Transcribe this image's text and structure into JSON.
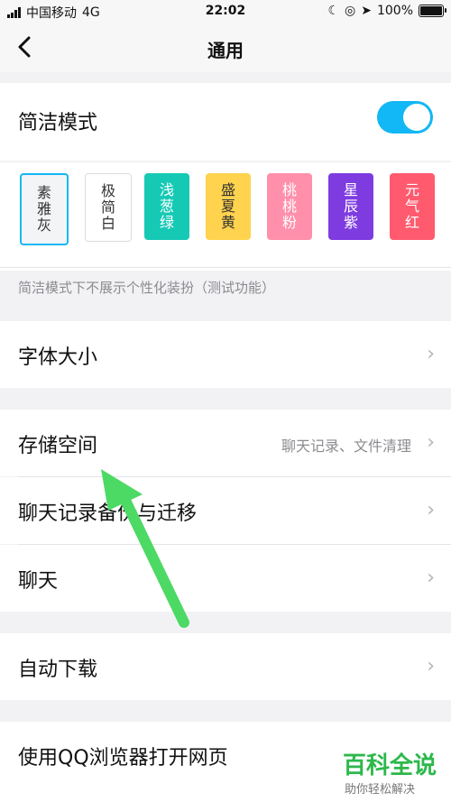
{
  "status_bar": {
    "carrier": "中国移动",
    "network": "4G",
    "time": "22:02",
    "battery": "100%"
  },
  "nav": {
    "title": "通用"
  },
  "simple_mode": {
    "label": "简洁模式",
    "enabled": true,
    "themes": [
      {
        "name": "素雅灰",
        "lines": [
          "素",
          "雅",
          "灰"
        ],
        "color": "#f3f4f6",
        "text_color": "#333333",
        "selected": true
      },
      {
        "name": "极简白",
        "lines": [
          "极",
          "简",
          "白"
        ],
        "color": "#ffffff",
        "text_color": "#333333",
        "selected": false
      },
      {
        "name": "浅葱绿",
        "lines": [
          "浅",
          "葱",
          "绿"
        ],
        "color": "#16c9b5",
        "text_color": "#ffffff",
        "selected": false
      },
      {
        "name": "盛夏黄",
        "lines": [
          "盛",
          "夏",
          "黄"
        ],
        "color": "#ffd34d",
        "text_color": "#333333",
        "selected": false
      },
      {
        "name": "桃桃粉",
        "lines": [
          "桃",
          "桃",
          "粉"
        ],
        "color": "#ff8fab",
        "text_color": "#ffffff",
        "selected": false
      },
      {
        "name": "星辰紫",
        "lines": [
          "星",
          "辰",
          "紫"
        ],
        "color": "#7e3be0",
        "text_color": "#ffffff",
        "selected": false
      },
      {
        "name": "元气红",
        "lines": [
          "元",
          "气",
          "红"
        ],
        "color": "#ff5a6e",
        "text_color": "#ffffff",
        "selected": false
      }
    ],
    "hint": "简洁模式下不展示个性化装扮（测试功能）"
  },
  "rows": {
    "font_size": "字体大小",
    "storage": "存储空间",
    "storage_detail": "聊天记录、文件清理",
    "chat_backup": "聊天记录备份与迁移",
    "chat": "聊天",
    "auto_download": "自动下载",
    "qq_browser": "使用QQ浏览器打开网页"
  },
  "watermark": {
    "big": "百科全说",
    "small": "助你轻松解决"
  },
  "colors": {
    "accent": "#12b7f5",
    "arrow": "#4cd964"
  }
}
